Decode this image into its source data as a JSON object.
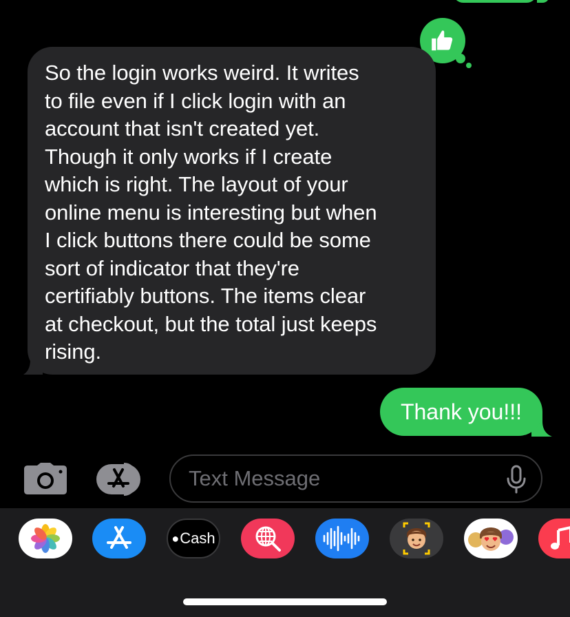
{
  "conversation": {
    "incoming_message": [
      "So the login works weird. It writes",
      "to file even if I click login with an",
      "account that isn't created yet.",
      "Though it only works if I create",
      "which is right. The layout of your",
      "online menu is interesting but when",
      "I click buttons there could be some",
      "sort of indicator that they're",
      "certifiably buttons. The items clear",
      "at checkout, but the total just keeps",
      "rising."
    ],
    "outgoing_message": "Thank you!!!",
    "tapback": "thumbs-up-icon"
  },
  "input_bar": {
    "placeholder": "Text Message",
    "camera_icon": "camera-icon",
    "apps_icon": "app-store-icon",
    "mic_icon": "microphone-icon"
  },
  "app_drawer": {
    "apps": [
      {
        "name": "photos-app",
        "icon": "photos-icon"
      },
      {
        "name": "app-store-app",
        "icon": "app-store-icon"
      },
      {
        "name": "apple-cash-app",
        "label": "Cash"
      },
      {
        "name": "images-search-app",
        "icon": "globe-search-icon"
      },
      {
        "name": "audio-message-app",
        "icon": "waveform-icon"
      },
      {
        "name": "memoji-app",
        "icon": "memoji-icon"
      },
      {
        "name": "memoji-stickers-app",
        "icon": "memoji-stickers-icon"
      },
      {
        "name": "music-app",
        "icon": "music-note-icon"
      }
    ]
  },
  "colors": {
    "background": "#000000",
    "incoming_bubble": "#262628",
    "outgoing_bubble": "#34c759",
    "drawer": "#1c1c1e",
    "placeholder": "#6e6e73"
  }
}
